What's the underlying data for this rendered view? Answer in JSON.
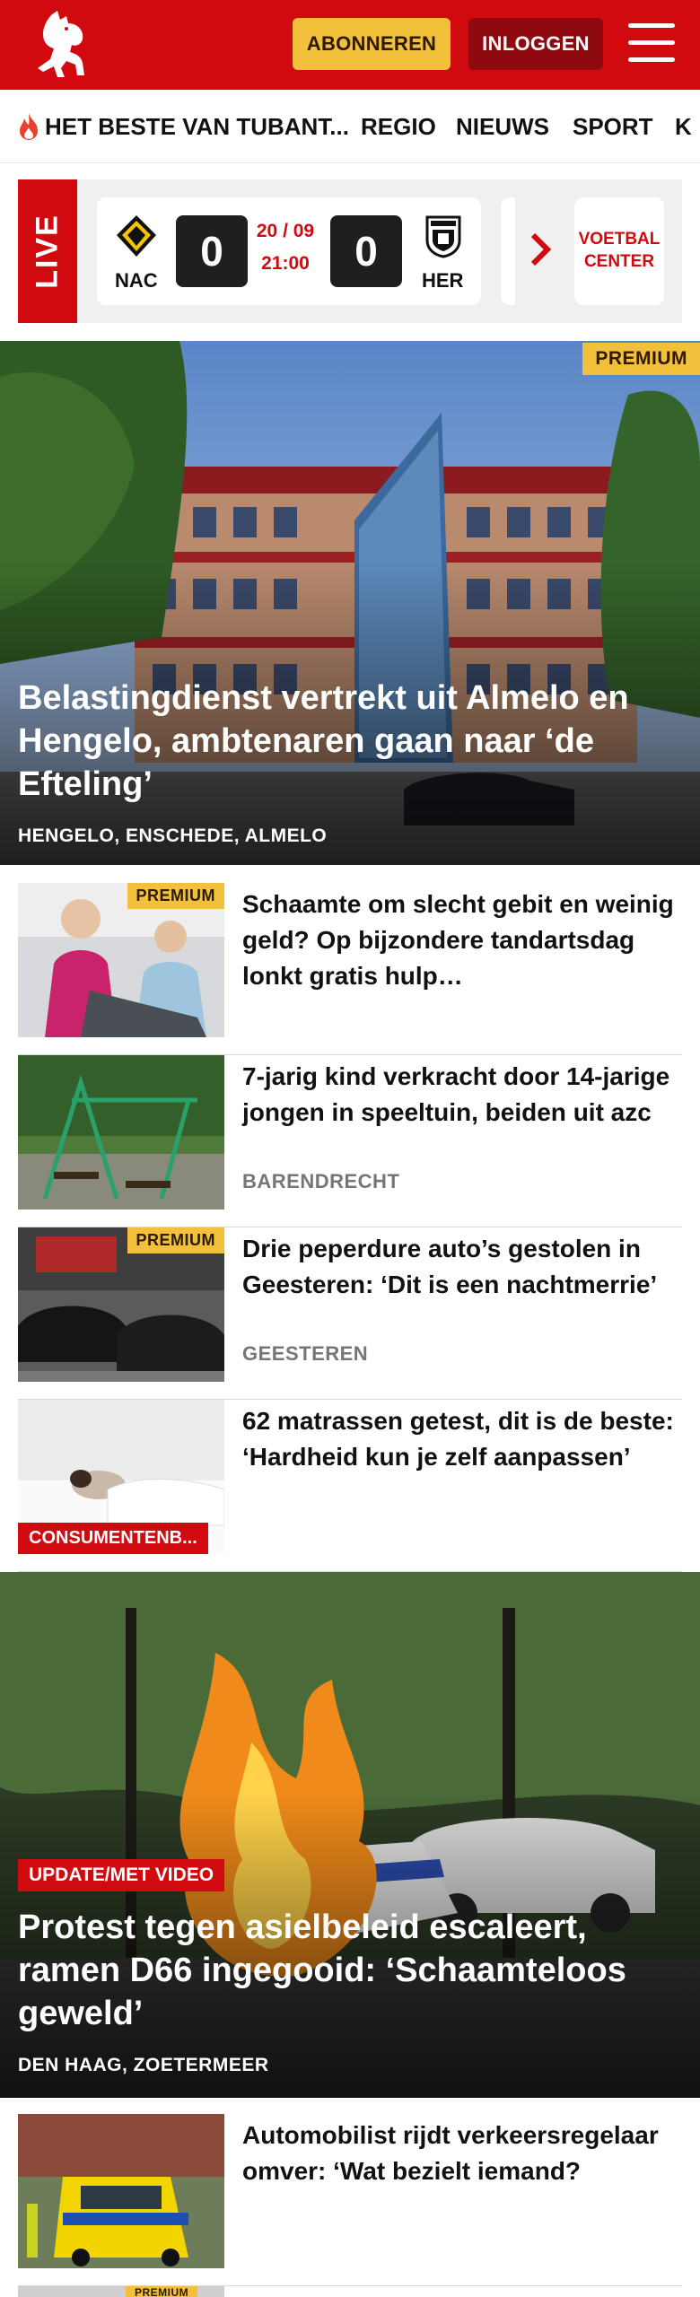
{
  "header": {
    "subscribe_label": "ABONNEREN",
    "login_label": "INLOGGEN",
    "brand_color": "#d10a10"
  },
  "nav": {
    "items": [
      {
        "label": "HET BESTE VAN TUBANT...",
        "icon": "flame-icon"
      },
      {
        "label": "REGIO"
      },
      {
        "label": "NIEUWS"
      },
      {
        "label": "SPORT"
      },
      {
        "label": "K"
      }
    ]
  },
  "live": {
    "tag": "LIVE",
    "home_team": "NAC",
    "away_team": "HER",
    "home_score": "0",
    "away_score": "0",
    "date": "20 / 09",
    "time": "21:00",
    "voetbalcenter_line1": "VOETBAL",
    "voetbalcenter_line2": "CENTER"
  },
  "hero1": {
    "badge": "PREMIUM",
    "title": "Belastingdienst vertrekt uit Almelo en Hengelo, ambtenaren gaan naar ‘de Efteling’",
    "location": "HENGELO, ENSCHEDE, ALMELO"
  },
  "articles": [
    {
      "title": "Schaamte om slecht gebit en weinig geld? Op bijzondere tandartsdag lonkt gratis hulp…",
      "badge": "PREMIUM",
      "location": ""
    },
    {
      "title": "7-jarig kind verkracht door 14-jarige jongen in speeltuin, beiden uit azc",
      "badge": "",
      "location": "BARENDRECHT"
    },
    {
      "title": "Drie peperdure auto’s gestolen in Geesteren: ‘Dit is een nachtmer­rie’",
      "badge": "PREMIUM",
      "location": "GEESTEREN"
    },
    {
      "title": "62 matrassen getest, dit is de beste: ‘Hardheid kun je zelf aanpassen’",
      "badge": "CONSUMENTENB...",
      "location": ""
    }
  ],
  "hero2": {
    "badge": "UPDATE/MET VIDEO",
    "title": "Protest tegen asielbeleid escaleert, ramen D66 ingegooid: ‘Schaamteloos geweld’",
    "location": "DEN HAAG, ZOETERMEER"
  },
  "articles2": [
    {
      "title": "Automobilist rijdt verkeersrege­laar omver: ‘Wat bezielt iemand?",
      "badge": "",
      "location": ""
    },
    {
      "title": "",
      "badge": "PREMIUM",
      "location": ""
    }
  ]
}
